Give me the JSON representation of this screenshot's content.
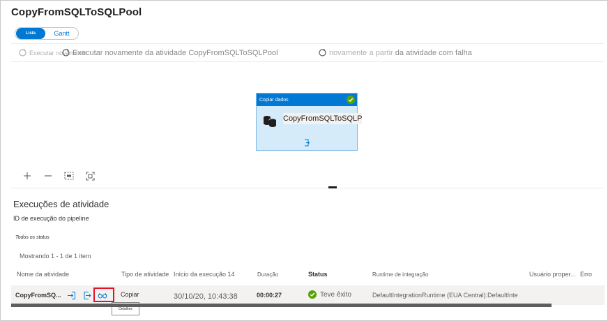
{
  "pipeline": {
    "title": "CopyFromSQLToSQLPool"
  },
  "view_toggle": {
    "active": "Lista",
    "inactive": "Gantt"
  },
  "toolbar": {
    "rerun_short": "Executar novamente",
    "rerun_activity": "Executar novamente da atividade CopyFromSQLToSQLPool",
    "rerun_failed_a": "novamente a partir",
    "rerun_failed_b": "da atividade com falha"
  },
  "activity_card": {
    "header": "Copiar dados",
    "name": "CopyFromSQLToSQLPool",
    "name_overflow": "ol"
  },
  "canvas_controls": [
    "zoom-in",
    "zoom-out",
    "zoom-100",
    "fit-to-screen"
  ],
  "runs": {
    "section_title": "Execuções de atividade",
    "pipeline_run_id_label": "ID de execução do pipeline",
    "status_filter": "Todos os status",
    "showing": "Mostrando 1 - 1 de 1 item"
  },
  "table": {
    "columns": {
      "activity_name": "Nome da atividade",
      "activity_type": "Tipo de atividade",
      "run_start": "Início da execução 14",
      "duration": "Duração",
      "status": "Status",
      "integration_runtime": "Runtime de integração",
      "user_properties": "Usuário proper...",
      "error": "Erro"
    },
    "rows": [
      {
        "activity_name": "CopyFromSQ...",
        "activity_type": "Copiar",
        "run_start": "30/10/20, 10:43:38",
        "duration": "00:00:27",
        "status": "Teve êxito",
        "integration_runtime": "DefaultIntegrationRuntime (EUA Central):DefaultInte"
      }
    ],
    "tooltip": "Detalhes"
  },
  "colors": {
    "accent": "#0078d4",
    "success": "#57a300",
    "highlight": "#e81123",
    "card_bg": "#d6ebfa"
  }
}
